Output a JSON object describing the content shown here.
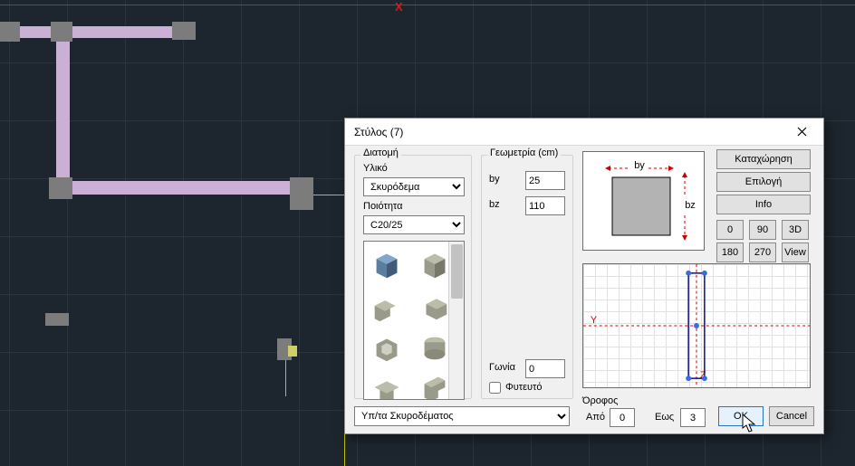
{
  "canvas": {
    "xaxis_label": "X"
  },
  "dialog": {
    "title": "Στύλος (7)",
    "section": {
      "diatomi": "Διατομή",
      "material_label": "Υλικό",
      "material_value": "Σκυρόδεμα",
      "quality_label": "Ποιότητα",
      "quality_value": "C20/25"
    },
    "geometry": {
      "legend": "Γεωμετρία (cm)",
      "by_label": "by",
      "by_value": "25",
      "bz_label": "bz",
      "bz_value": "110",
      "angle_label": "Γωνία",
      "angle_value": "0",
      "planted_label": "Φυτευτό"
    },
    "preview": {
      "by_dim": "by",
      "bz_dim": "bz",
      "y_axis": "Y",
      "z_axis": "Z"
    },
    "right_buttons": {
      "register": "Καταχώρηση",
      "select": "Επιλογή",
      "info": "Info",
      "r0": "0",
      "r90": "90",
      "r3d": "3D",
      "r180": "180",
      "r270": "270",
      "rview": "View"
    },
    "floor": {
      "legend": "Όροφος",
      "from_label": "Από",
      "from_value": "0",
      "to_label": "Εως",
      "to_value": "3"
    },
    "footer": {
      "combo_value": "Υπ/τα Σκυροδέματος",
      "ok": "OK",
      "cancel": "Cancel"
    }
  }
}
